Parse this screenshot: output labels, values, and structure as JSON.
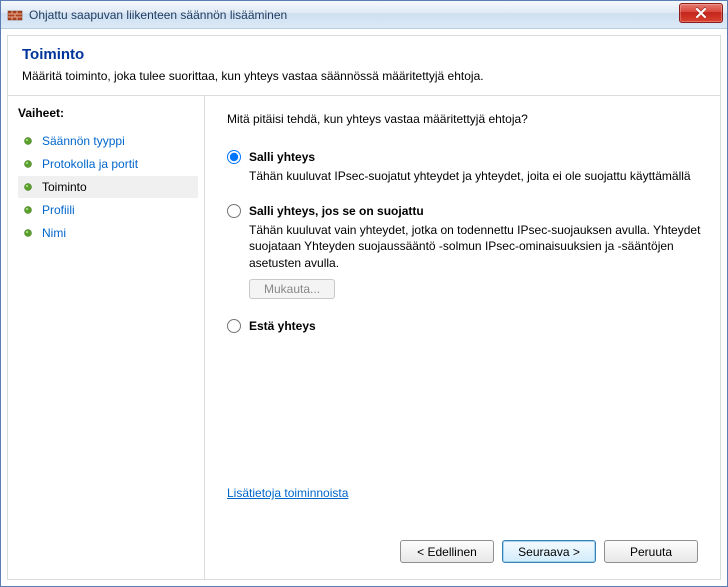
{
  "window": {
    "title": "Ohjattu saapuvan liikenteen säännön lisääminen"
  },
  "header": {
    "title": "Toiminto",
    "description": "Määritä toiminto, joka tulee suorittaa, kun yhteys vastaa säännössä määritettyjä ehtoja."
  },
  "sidebar": {
    "title": "Vaiheet:",
    "steps": [
      {
        "label": "Säännön tyyppi"
      },
      {
        "label": "Protokolla ja portit"
      },
      {
        "label": "Toiminto"
      },
      {
        "label": "Profiili"
      },
      {
        "label": "Nimi"
      }
    ],
    "current_index": 2
  },
  "main": {
    "question": "Mitä pitäisi tehdä, kun yhteys vastaa määritettyjä ehtoja?",
    "options": [
      {
        "label": "Salli yhteys",
        "description": "Tähän kuuluvat IPsec-suojatut yhteydet ja yhteydet, joita ei ole suojattu käyttämällä",
        "selected": true
      },
      {
        "label": "Salli yhteys, jos se on suojattu",
        "description": "Tähän kuuluvat vain yhteydet, jotka on todennettu IPsec-suojauksen avulla. Yhteydet suojataan Yhteyden suojaussääntö -solmun IPsec-ominaisuuksien ja -sääntöjen asetusten avulla.",
        "customize_label": "Mukauta...",
        "selected": false
      },
      {
        "label": "Estä yhteys",
        "selected": false
      }
    ],
    "more_info_link": "Lisätietoja toiminnoista"
  },
  "buttons": {
    "back": "< Edellinen",
    "next": "Seuraava >",
    "cancel": "Peruuta"
  }
}
